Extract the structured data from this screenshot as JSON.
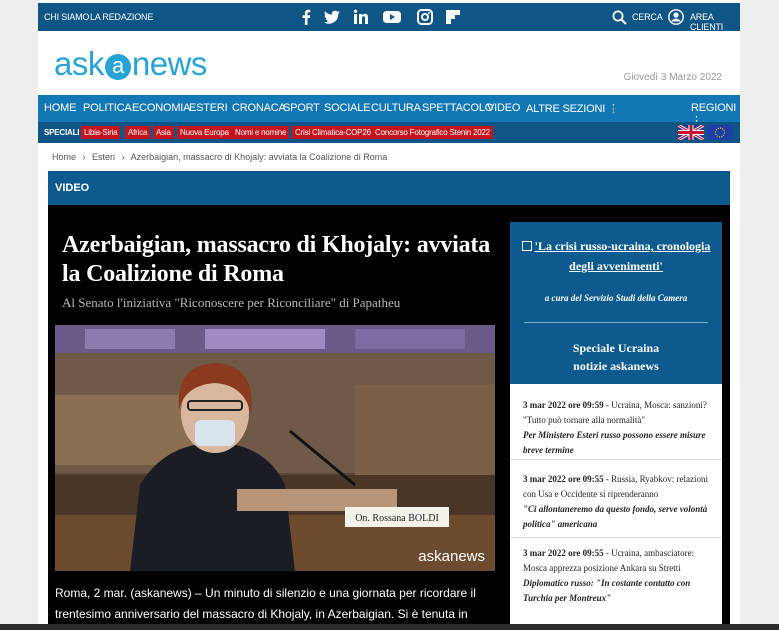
{
  "topbar": {
    "chi_siamo": "CHI SIAMO",
    "redazione": "LA REDAZIONE",
    "cerca": "CERCA",
    "area_clienti": "AREA CLIENTI",
    "social_icons": [
      "facebook-icon",
      "twitter-icon",
      "linkedin-icon",
      "youtube-icon",
      "instagram-icon",
      "flipboard-icon"
    ]
  },
  "brand": {
    "logo_left": "ask",
    "logo_mid": "a",
    "logo_right": "news",
    "date": "Giovedì 3 Marzo 2022"
  },
  "nav": {
    "items": [
      "HOME",
      "POLITICA",
      "ECONOMIA",
      "ESTERI",
      "CRONACA",
      "SPORT",
      "SOCIALE",
      "CULTURA",
      "SPETTACOLO",
      "VIDEO",
      "ALTRE SEZIONI ⋮"
    ],
    "regioni": "REGIONI ⋮"
  },
  "special": {
    "label": "SPECIALI",
    "tags": [
      "Libia-Siria",
      "Africa",
      "Asia",
      "Nuova Europa",
      "Nomi e nomine",
      "Crisi Climatica-COP26",
      "Concorso Fotografico Stenin 2022"
    ]
  },
  "breadcrumb": {
    "home": "Home",
    "sep": "›",
    "section": "Esteri",
    "current": "Azerbaigian, massacro di Khojaly: avviata la Coalizione di Roma"
  },
  "section_title": "VIDEO",
  "article": {
    "headline": "Azerbaigian, massacro di Khojaly: avviata la Coalizione di Roma",
    "subhead": "Al Senato l'iniziativa \"Riconoscere per Riconciliare\" di Papatheu",
    "video_caption": "On. Rossana BOLDI",
    "video_watermark": "askanews",
    "body": "Roma, 2 mar. (askanews) – Un minuto di silenzio e una giornata per ricordare il trentesimo anniversario del massacro di Khojaly, in Azerbaigian. Si è tenuta in"
  },
  "sidebar": {
    "chronology_link": "'La crisi russo-ucraina, cronologia degli avvenimenti'",
    "chronology_sub": "a cura del Servizio Studi della Camera",
    "ukraine_title": "Speciale Ucraina notizie askanews",
    "news": [
      {
        "time": "3 mar 2022 ore 09:59",
        "text": " - Ucraina, Mosca: sanzioni? \"Tutto può tornare alla normalità\"",
        "quote": "Per Ministero Esteri russo possono essere misure breve termine"
      },
      {
        "time": "3 mar 2022 ore 09:55",
        "text": " - Russia, Ryabkov: relazioni con Usa e Occidente si riprenderanno",
        "quote": "\"Ci allontaneremo da questo fondo, serve volontà politica\" americana"
      },
      {
        "time": "3 mar 2022 ore 09:55",
        "text": " - Ucraina, ambasciatore: Mosca apprezza posizione Ankara su Stretti",
        "quote": "Diplomatico russo: \"In costante contatto con Turchia per Montreux\""
      }
    ]
  },
  "colors": {
    "topbar": "#0f5585",
    "nav": "#1277b5",
    "accent": "#27a3d8",
    "tag": "#c4141c"
  }
}
